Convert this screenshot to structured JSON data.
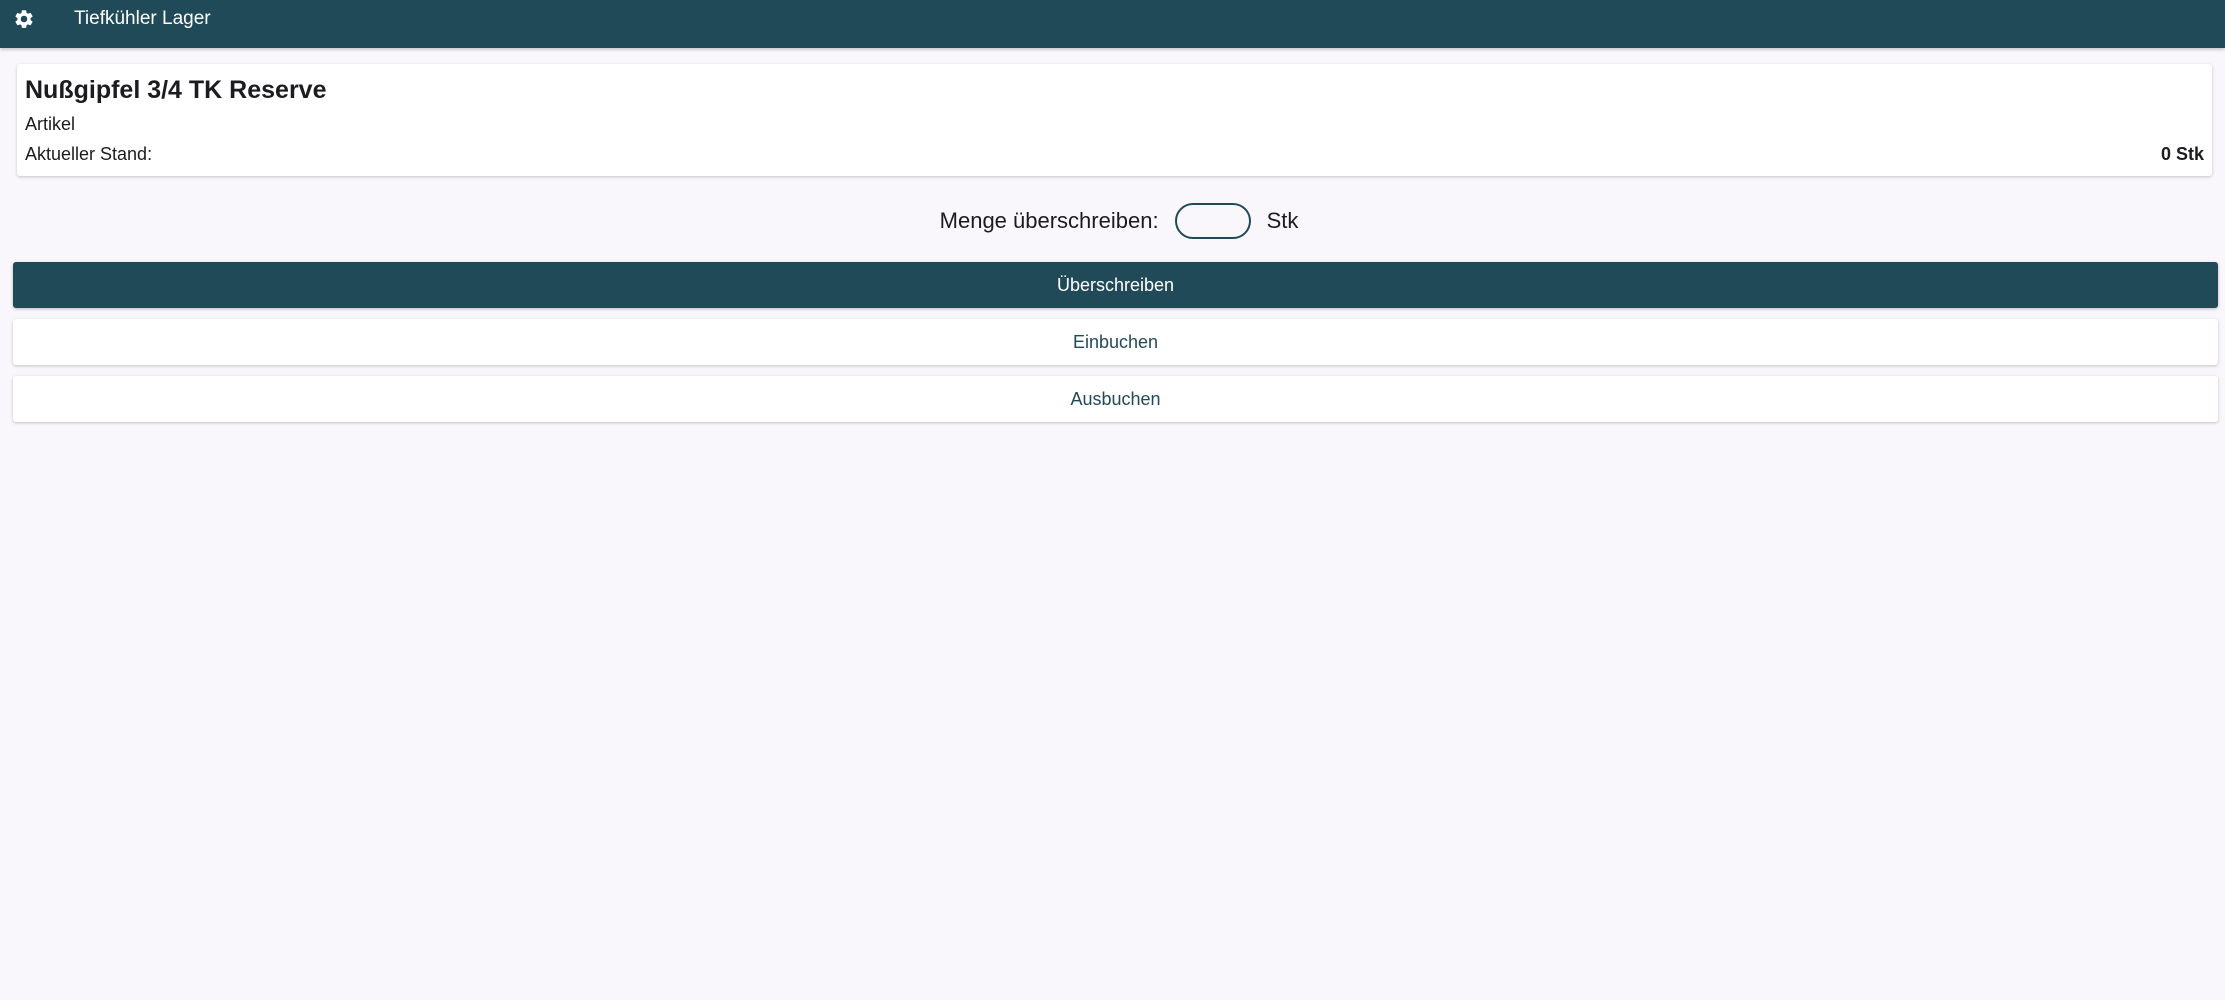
{
  "header": {
    "title": "Tiefkühler Lager",
    "settings_icon": "gear-icon",
    "background_color": "#214a59"
  },
  "item": {
    "name": "Nußgipfel 3/4 TK Reserve",
    "type": "Artikel",
    "stock_label": "Aktueller Stand:",
    "stock_value": "0 Stk"
  },
  "override": {
    "label": "Menge überschreiben:",
    "value": "",
    "placeholder": "",
    "unit": "Stk"
  },
  "actions": {
    "overwrite_label": "Überschreiben",
    "book_in_label": "Einbuchen",
    "book_out_label": "Ausbuchen"
  },
  "colors": {
    "accent": "#214a59",
    "background": "#f9f7fb",
    "card": "#ffffff"
  }
}
